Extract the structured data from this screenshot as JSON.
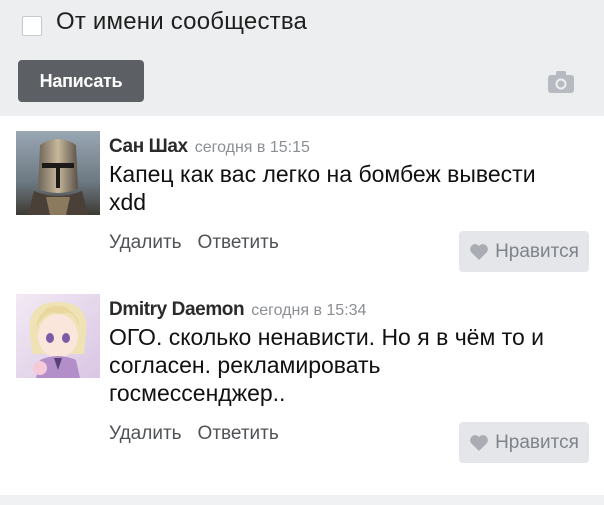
{
  "composer": {
    "community_checkbox_label": "От имени сообщества",
    "write_button_label": "Написать",
    "camera_icon": "camera-icon"
  },
  "comments": [
    {
      "author": "Сан Шах",
      "time": "сегодня в 15:15",
      "text_lines": [
        "Капец как вас легко на бомбеж вывести",
        "xdd"
      ],
      "actions": [
        "Удалить",
        "Ответить"
      ],
      "like_label": "Нравится",
      "avatar": "knight-helmet-avatar"
    },
    {
      "author": "Dmitry Daemon",
      "time": "сегодня в 15:34",
      "text_lines": [
        "ОГО. сколько ненависти. Но я в чём то и",
        "согласен. рекламировать",
        "госмессенджер.."
      ],
      "actions": [
        "Удалить",
        "Ответить"
      ],
      "like_label": "Нравится",
      "avatar": "anime-girl-avatar"
    }
  ],
  "colors": {
    "composer_bg": "#edeef0",
    "write_button": "#5c5f63",
    "like_button_bg": "#e4e6e9",
    "time_text": "#8b8e93"
  }
}
